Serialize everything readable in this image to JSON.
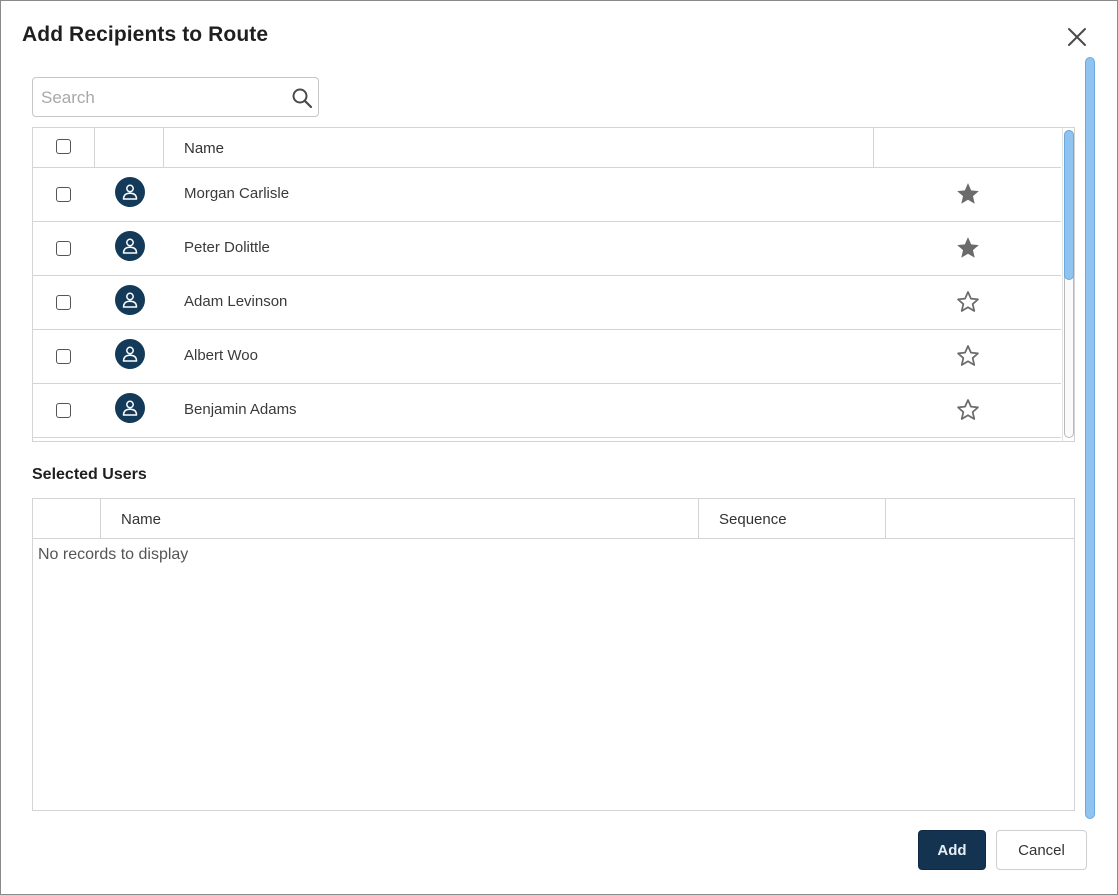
{
  "dialog": {
    "title": "Add Recipients to Route"
  },
  "search": {
    "placeholder": "Search",
    "value": ""
  },
  "recipients": {
    "columns": {
      "name": "Name"
    },
    "rows": [
      {
        "name": "Morgan Carlisle",
        "favorite": true
      },
      {
        "name": "Peter Dolittle",
        "favorite": true
      },
      {
        "name": "Adam Levinson",
        "favorite": false
      },
      {
        "name": "Albert Woo",
        "favorite": false
      },
      {
        "name": "Benjamin Adams",
        "favorite": false
      }
    ]
  },
  "selected_users": {
    "title": "Selected Users",
    "columns": {
      "name": "Name",
      "sequence": "Sequence"
    },
    "empty_message": "No records to display"
  },
  "buttons": {
    "add": "Add",
    "cancel": "Cancel"
  },
  "colors": {
    "primary": "#143350",
    "avatar": "#143a5a",
    "scrollbar": "#8fc3f0",
    "star": "#6b6b6b"
  },
  "icons": {
    "close": "close-icon",
    "search": "search-icon",
    "avatar": "user-icon",
    "favorite_on": "star-filled-icon",
    "favorite_off": "star-outline-icon"
  }
}
